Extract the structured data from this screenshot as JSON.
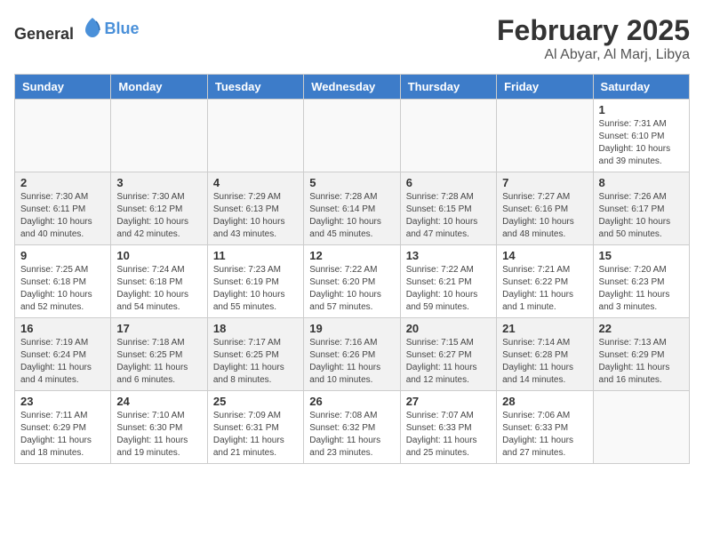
{
  "logo": {
    "general": "General",
    "blue": "Blue"
  },
  "title": {
    "month": "February 2025",
    "location": "Al Abyar, Al Marj, Libya"
  },
  "weekdays": [
    "Sunday",
    "Monday",
    "Tuesday",
    "Wednesday",
    "Thursday",
    "Friday",
    "Saturday"
  ],
  "weeks": [
    [
      {
        "day": "",
        "detail": ""
      },
      {
        "day": "",
        "detail": ""
      },
      {
        "day": "",
        "detail": ""
      },
      {
        "day": "",
        "detail": ""
      },
      {
        "day": "",
        "detail": ""
      },
      {
        "day": "",
        "detail": ""
      },
      {
        "day": "1",
        "detail": "Sunrise: 7:31 AM\nSunset: 6:10 PM\nDaylight: 10 hours\nand 39 minutes."
      }
    ],
    [
      {
        "day": "2",
        "detail": "Sunrise: 7:30 AM\nSunset: 6:11 PM\nDaylight: 10 hours\nand 40 minutes."
      },
      {
        "day": "3",
        "detail": "Sunrise: 7:30 AM\nSunset: 6:12 PM\nDaylight: 10 hours\nand 42 minutes."
      },
      {
        "day": "4",
        "detail": "Sunrise: 7:29 AM\nSunset: 6:13 PM\nDaylight: 10 hours\nand 43 minutes."
      },
      {
        "day": "5",
        "detail": "Sunrise: 7:28 AM\nSunset: 6:14 PM\nDaylight: 10 hours\nand 45 minutes."
      },
      {
        "day": "6",
        "detail": "Sunrise: 7:28 AM\nSunset: 6:15 PM\nDaylight: 10 hours\nand 47 minutes."
      },
      {
        "day": "7",
        "detail": "Sunrise: 7:27 AM\nSunset: 6:16 PM\nDaylight: 10 hours\nand 48 minutes."
      },
      {
        "day": "8",
        "detail": "Sunrise: 7:26 AM\nSunset: 6:17 PM\nDaylight: 10 hours\nand 50 minutes."
      }
    ],
    [
      {
        "day": "9",
        "detail": "Sunrise: 7:25 AM\nSunset: 6:18 PM\nDaylight: 10 hours\nand 52 minutes."
      },
      {
        "day": "10",
        "detail": "Sunrise: 7:24 AM\nSunset: 6:18 PM\nDaylight: 10 hours\nand 54 minutes."
      },
      {
        "day": "11",
        "detail": "Sunrise: 7:23 AM\nSunset: 6:19 PM\nDaylight: 10 hours\nand 55 minutes."
      },
      {
        "day": "12",
        "detail": "Sunrise: 7:22 AM\nSunset: 6:20 PM\nDaylight: 10 hours\nand 57 minutes."
      },
      {
        "day": "13",
        "detail": "Sunrise: 7:22 AM\nSunset: 6:21 PM\nDaylight: 10 hours\nand 59 minutes."
      },
      {
        "day": "14",
        "detail": "Sunrise: 7:21 AM\nSunset: 6:22 PM\nDaylight: 11 hours\nand 1 minute."
      },
      {
        "day": "15",
        "detail": "Sunrise: 7:20 AM\nSunset: 6:23 PM\nDaylight: 11 hours\nand 3 minutes."
      }
    ],
    [
      {
        "day": "16",
        "detail": "Sunrise: 7:19 AM\nSunset: 6:24 PM\nDaylight: 11 hours\nand 4 minutes."
      },
      {
        "day": "17",
        "detail": "Sunrise: 7:18 AM\nSunset: 6:25 PM\nDaylight: 11 hours\nand 6 minutes."
      },
      {
        "day": "18",
        "detail": "Sunrise: 7:17 AM\nSunset: 6:25 PM\nDaylight: 11 hours\nand 8 minutes."
      },
      {
        "day": "19",
        "detail": "Sunrise: 7:16 AM\nSunset: 6:26 PM\nDaylight: 11 hours\nand 10 minutes."
      },
      {
        "day": "20",
        "detail": "Sunrise: 7:15 AM\nSunset: 6:27 PM\nDaylight: 11 hours\nand 12 minutes."
      },
      {
        "day": "21",
        "detail": "Sunrise: 7:14 AM\nSunset: 6:28 PM\nDaylight: 11 hours\nand 14 minutes."
      },
      {
        "day": "22",
        "detail": "Sunrise: 7:13 AM\nSunset: 6:29 PM\nDaylight: 11 hours\nand 16 minutes."
      }
    ],
    [
      {
        "day": "23",
        "detail": "Sunrise: 7:11 AM\nSunset: 6:29 PM\nDaylight: 11 hours\nand 18 minutes."
      },
      {
        "day": "24",
        "detail": "Sunrise: 7:10 AM\nSunset: 6:30 PM\nDaylight: 11 hours\nand 19 minutes."
      },
      {
        "day": "25",
        "detail": "Sunrise: 7:09 AM\nSunset: 6:31 PM\nDaylight: 11 hours\nand 21 minutes."
      },
      {
        "day": "26",
        "detail": "Sunrise: 7:08 AM\nSunset: 6:32 PM\nDaylight: 11 hours\nand 23 minutes."
      },
      {
        "day": "27",
        "detail": "Sunrise: 7:07 AM\nSunset: 6:33 PM\nDaylight: 11 hours\nand 25 minutes."
      },
      {
        "day": "28",
        "detail": "Sunrise: 7:06 AM\nSunset: 6:33 PM\nDaylight: 11 hours\nand 27 minutes."
      },
      {
        "day": "",
        "detail": ""
      }
    ]
  ]
}
